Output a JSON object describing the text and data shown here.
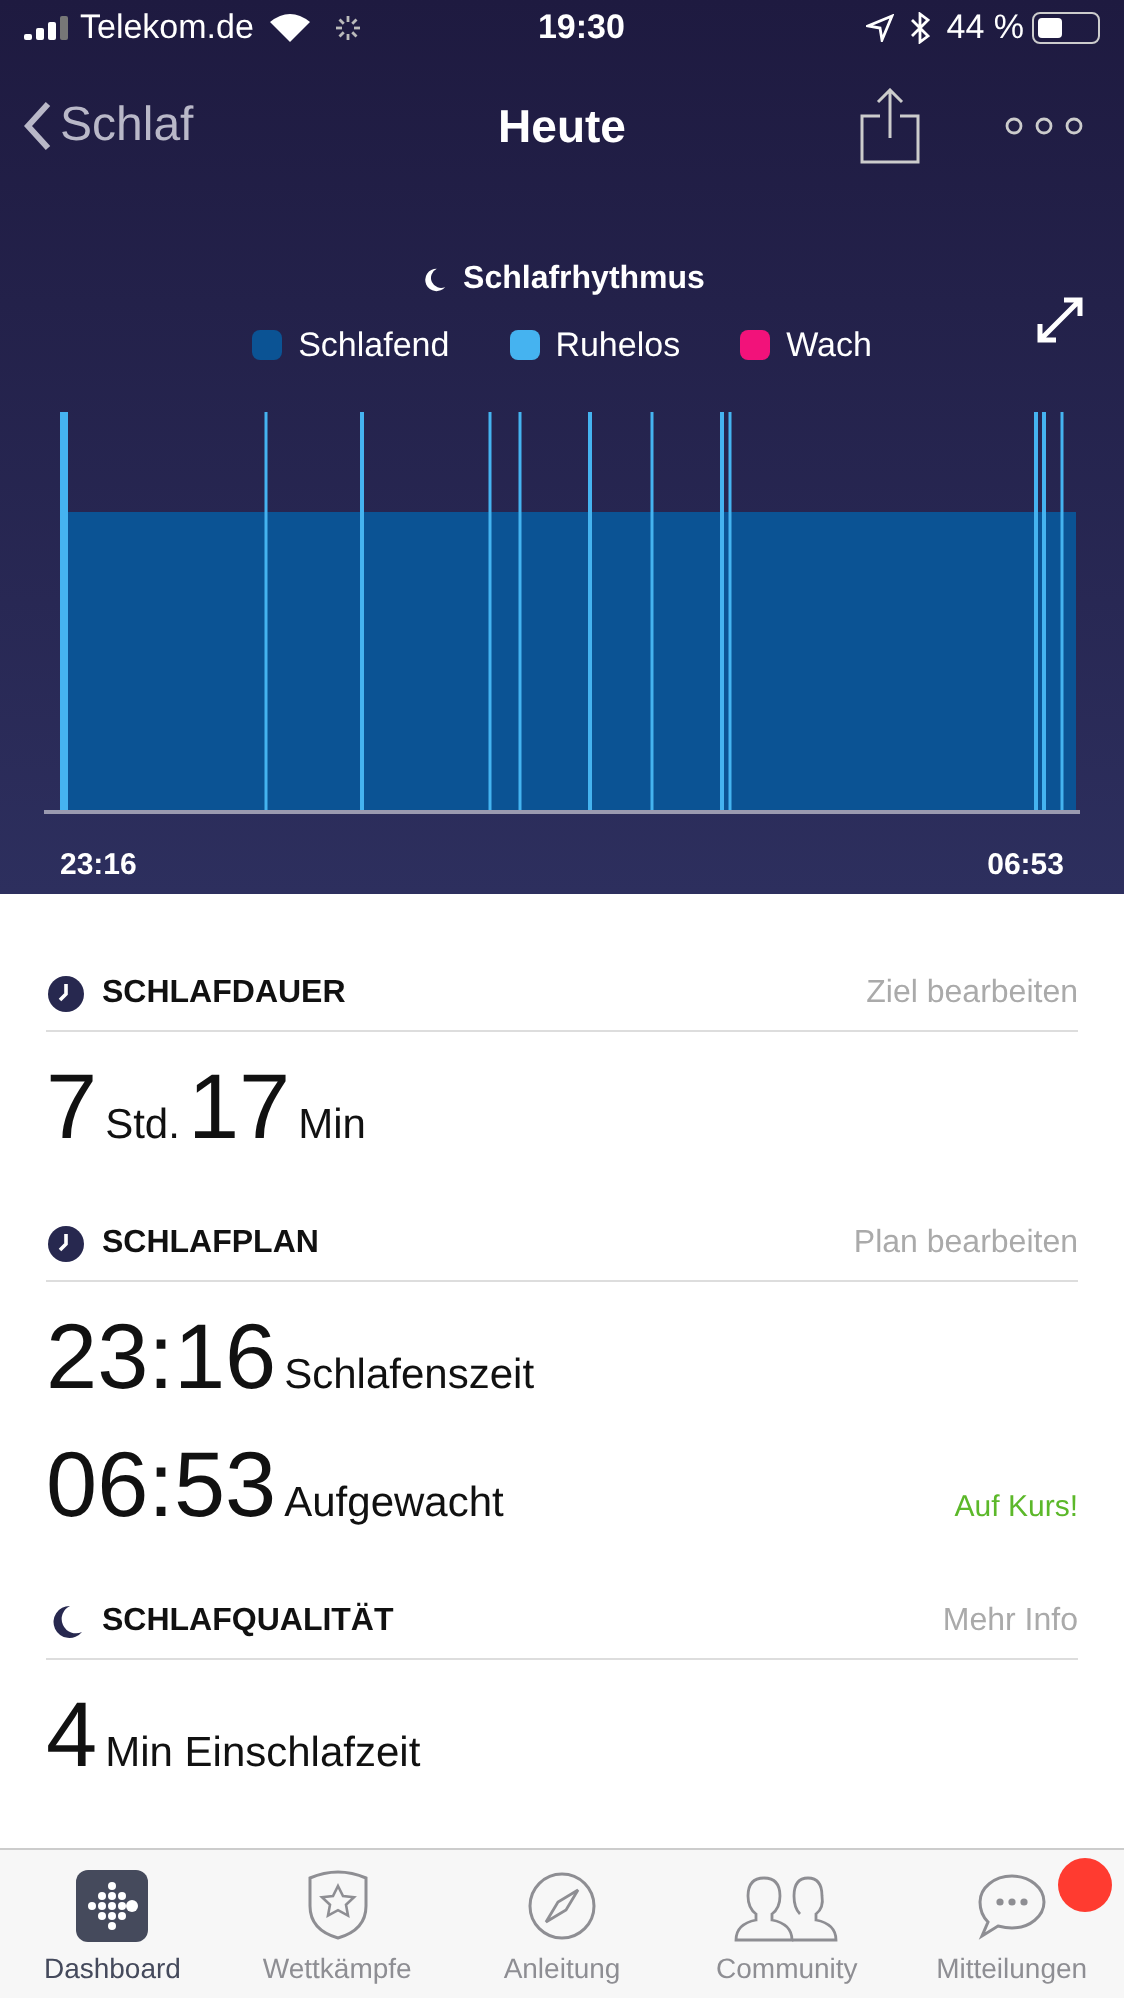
{
  "status_bar": {
    "carrier": "Telekom.de",
    "time": "19:30",
    "battery": "44 %"
  },
  "nav": {
    "back": "Schlaf",
    "title": "Heute"
  },
  "chart": {
    "title": "Schlafrhythmus",
    "legend": [
      {
        "label": "Schlafend",
        "color": "#0b5394"
      },
      {
        "label": "Ruhelos",
        "color": "#45b3f0"
      },
      {
        "label": "Wach",
        "color": "#f2127a"
      }
    ],
    "start": "23:16",
    "end": "06:53"
  },
  "sections": [
    {
      "kind": "clock",
      "title": "SCHLAFDAUER",
      "action": "Ziel bearbeiten",
      "rows": [
        {
          "parts": [
            {
              "kind": "big",
              "text": "7"
            },
            {
              "kind": "small",
              "text": "Std."
            },
            {
              "kind": "big",
              "text": "17"
            },
            {
              "kind": "small",
              "text": "Min"
            }
          ]
        }
      ]
    },
    {
      "kind": "clock",
      "title": "SCHLAFPLAN",
      "action": "Plan bearbeiten",
      "rows": [
        {
          "parts": [
            {
              "kind": "big",
              "text": "23:16"
            },
            {
              "kind": "small",
              "text": "Schlafenszeit"
            }
          ]
        },
        {
          "parts": [
            {
              "kind": "big",
              "text": "06:53"
            },
            {
              "kind": "small",
              "text": "Aufgewacht"
            }
          ],
          "status": "Auf Kurs!"
        }
      ]
    },
    {
      "kind": "moon",
      "title": "SCHLAFQUALITÄT",
      "action": "Mehr Info",
      "rows": [
        {
          "parts": [
            {
              "kind": "big",
              "text": "4"
            },
            {
              "kind": "small",
              "text": "Min Einschlafzeit"
            }
          ]
        }
      ]
    }
  ],
  "tabs": [
    {
      "kind": "dashboard",
      "label": "Dashboard",
      "selected": true,
      "badge": false
    },
    {
      "kind": "contests",
      "label": "Wettkämpfe",
      "selected": false,
      "badge": false
    },
    {
      "kind": "guide",
      "label": "Anleitung",
      "selected": false,
      "badge": false
    },
    {
      "kind": "community",
      "label": "Community",
      "selected": false,
      "badge": false
    },
    {
      "kind": "messages",
      "label": "Mitteilungen",
      "selected": false,
      "badge": true
    }
  ]
}
